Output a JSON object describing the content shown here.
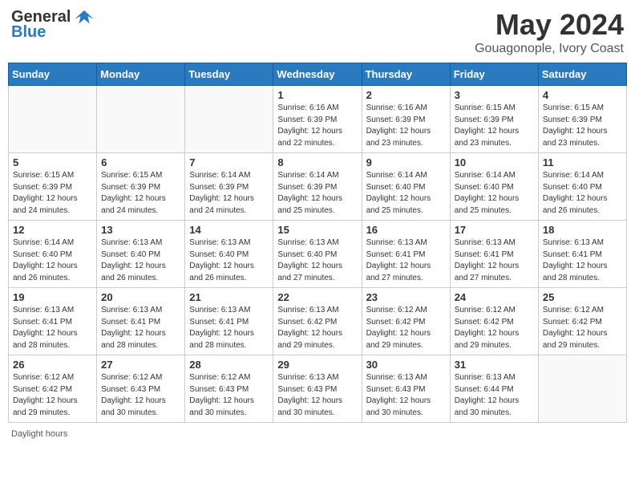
{
  "header": {
    "logo_general": "General",
    "logo_blue": "Blue",
    "title": "May 2024",
    "subtitle": "Gouagonople, Ivory Coast"
  },
  "weekdays": [
    "Sunday",
    "Monday",
    "Tuesday",
    "Wednesday",
    "Thursday",
    "Friday",
    "Saturday"
  ],
  "weeks": [
    [
      {
        "day": "",
        "info": "",
        "empty": true
      },
      {
        "day": "",
        "info": "",
        "empty": true
      },
      {
        "day": "",
        "info": "",
        "empty": true
      },
      {
        "day": "1",
        "info": "Sunrise: 6:16 AM\nSunset: 6:39 PM\nDaylight: 12 hours\nand 22 minutes."
      },
      {
        "day": "2",
        "info": "Sunrise: 6:16 AM\nSunset: 6:39 PM\nDaylight: 12 hours\nand 23 minutes."
      },
      {
        "day": "3",
        "info": "Sunrise: 6:15 AM\nSunset: 6:39 PM\nDaylight: 12 hours\nand 23 minutes."
      },
      {
        "day": "4",
        "info": "Sunrise: 6:15 AM\nSunset: 6:39 PM\nDaylight: 12 hours\nand 23 minutes."
      }
    ],
    [
      {
        "day": "5",
        "info": "Sunrise: 6:15 AM\nSunset: 6:39 PM\nDaylight: 12 hours\nand 24 minutes."
      },
      {
        "day": "6",
        "info": "Sunrise: 6:15 AM\nSunset: 6:39 PM\nDaylight: 12 hours\nand 24 minutes."
      },
      {
        "day": "7",
        "info": "Sunrise: 6:14 AM\nSunset: 6:39 PM\nDaylight: 12 hours\nand 24 minutes."
      },
      {
        "day": "8",
        "info": "Sunrise: 6:14 AM\nSunset: 6:39 PM\nDaylight: 12 hours\nand 25 minutes."
      },
      {
        "day": "9",
        "info": "Sunrise: 6:14 AM\nSunset: 6:40 PM\nDaylight: 12 hours\nand 25 minutes."
      },
      {
        "day": "10",
        "info": "Sunrise: 6:14 AM\nSunset: 6:40 PM\nDaylight: 12 hours\nand 25 minutes."
      },
      {
        "day": "11",
        "info": "Sunrise: 6:14 AM\nSunset: 6:40 PM\nDaylight: 12 hours\nand 26 minutes."
      }
    ],
    [
      {
        "day": "12",
        "info": "Sunrise: 6:14 AM\nSunset: 6:40 PM\nDaylight: 12 hours\nand 26 minutes."
      },
      {
        "day": "13",
        "info": "Sunrise: 6:13 AM\nSunset: 6:40 PM\nDaylight: 12 hours\nand 26 minutes."
      },
      {
        "day": "14",
        "info": "Sunrise: 6:13 AM\nSunset: 6:40 PM\nDaylight: 12 hours\nand 26 minutes."
      },
      {
        "day": "15",
        "info": "Sunrise: 6:13 AM\nSunset: 6:40 PM\nDaylight: 12 hours\nand 27 minutes."
      },
      {
        "day": "16",
        "info": "Sunrise: 6:13 AM\nSunset: 6:41 PM\nDaylight: 12 hours\nand 27 minutes."
      },
      {
        "day": "17",
        "info": "Sunrise: 6:13 AM\nSunset: 6:41 PM\nDaylight: 12 hours\nand 27 minutes."
      },
      {
        "day": "18",
        "info": "Sunrise: 6:13 AM\nSunset: 6:41 PM\nDaylight: 12 hours\nand 28 minutes."
      }
    ],
    [
      {
        "day": "19",
        "info": "Sunrise: 6:13 AM\nSunset: 6:41 PM\nDaylight: 12 hours\nand 28 minutes."
      },
      {
        "day": "20",
        "info": "Sunrise: 6:13 AM\nSunset: 6:41 PM\nDaylight: 12 hours\nand 28 minutes."
      },
      {
        "day": "21",
        "info": "Sunrise: 6:13 AM\nSunset: 6:41 PM\nDaylight: 12 hours\nand 28 minutes."
      },
      {
        "day": "22",
        "info": "Sunrise: 6:13 AM\nSunset: 6:42 PM\nDaylight: 12 hours\nand 29 minutes."
      },
      {
        "day": "23",
        "info": "Sunrise: 6:12 AM\nSunset: 6:42 PM\nDaylight: 12 hours\nand 29 minutes."
      },
      {
        "day": "24",
        "info": "Sunrise: 6:12 AM\nSunset: 6:42 PM\nDaylight: 12 hours\nand 29 minutes."
      },
      {
        "day": "25",
        "info": "Sunrise: 6:12 AM\nSunset: 6:42 PM\nDaylight: 12 hours\nand 29 minutes."
      }
    ],
    [
      {
        "day": "26",
        "info": "Sunrise: 6:12 AM\nSunset: 6:42 PM\nDaylight: 12 hours\nand 29 minutes."
      },
      {
        "day": "27",
        "info": "Sunrise: 6:12 AM\nSunset: 6:43 PM\nDaylight: 12 hours\nand 30 minutes."
      },
      {
        "day": "28",
        "info": "Sunrise: 6:12 AM\nSunset: 6:43 PM\nDaylight: 12 hours\nand 30 minutes."
      },
      {
        "day": "29",
        "info": "Sunrise: 6:13 AM\nSunset: 6:43 PM\nDaylight: 12 hours\nand 30 minutes."
      },
      {
        "day": "30",
        "info": "Sunrise: 6:13 AM\nSunset: 6:43 PM\nDaylight: 12 hours\nand 30 minutes."
      },
      {
        "day": "31",
        "info": "Sunrise: 6:13 AM\nSunset: 6:44 PM\nDaylight: 12 hours\nand 30 minutes."
      },
      {
        "day": "",
        "info": "",
        "empty": true
      }
    ]
  ],
  "footer": {
    "daylight_label": "Daylight hours"
  }
}
